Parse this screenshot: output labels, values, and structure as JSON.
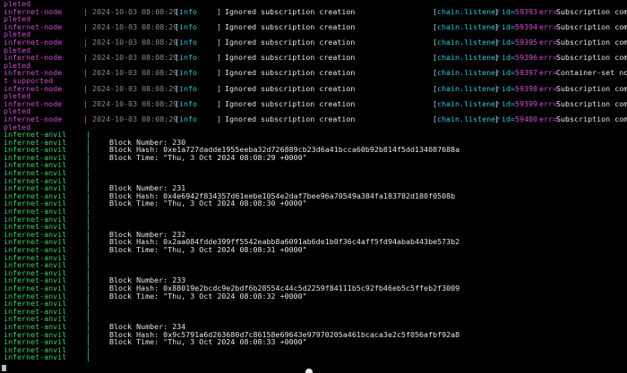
{
  "window": {
    "title": ""
  },
  "first_line_clipped": "pleted",
  "node_logs": [
    {
      "source": "infernet-node",
      "timestamp": "2024-10-03 08:08:29",
      "level": "info",
      "message": "Ignored subscription creation",
      "component": "chain.listener",
      "id": "59393",
      "err": "Subscription com",
      "wrap": "pleted"
    },
    {
      "source": "infernet-node",
      "timestamp": "2024-10-03 08:08:29",
      "level": "info",
      "message": "Ignored subscription creation",
      "component": "chain.listener",
      "id": "59394",
      "err": "Subscription com",
      "wrap": "pleted"
    },
    {
      "source": "infernet-node",
      "timestamp": "2024-10-03 08:08:29",
      "level": "info",
      "message": "Ignored subscription creation",
      "component": "chain.listener",
      "id": "59395",
      "err": "Subscription com",
      "wrap": "pleted"
    },
    {
      "source": "infernet-node",
      "timestamp": "2024-10-03 08:08:29",
      "level": "info",
      "message": "Ignored subscription creation",
      "component": "chain.listener",
      "id": "59396",
      "err": "Subscription com",
      "wrap": "pleted"
    },
    {
      "source": "infernet-node",
      "timestamp": "2024-10-03 08:08:29",
      "level": "info",
      "message": "Ignored subscription creation",
      "component": "chain.listener",
      "id": "59397",
      "err": "Container-set no",
      "wrap": "t supported"
    },
    {
      "source": "infernet-node",
      "timestamp": "2024-10-03 08:08:29",
      "level": "info",
      "message": "Ignored subscription creation",
      "component": "chain.listener",
      "id": "59398",
      "err": "Subscription com",
      "wrap": "pleted"
    },
    {
      "source": "infernet-node",
      "timestamp": "2024-10-03 08:08:29",
      "level": "info",
      "message": "Ignored subscription creation",
      "component": "chain.listener",
      "id": "59399",
      "err": "Subscription com",
      "wrap": "pleted"
    },
    {
      "source": "infernet-node",
      "timestamp": "2024-10-03 08:08:29",
      "level": "info",
      "message": "Ignored subscription creation",
      "component": "chain.listener",
      "id": "59400",
      "err": "Subscription com",
      "wrap": "pleted"
    }
  ],
  "anvil_source": "infernet-anvil",
  "anvil_labels": {
    "number": "Block Number:",
    "hash": "Block Hash:",
    "time": "Block Time:"
  },
  "blocks": [
    {
      "number": "230",
      "hash": "0xe1a727dadde1955eeba32d726889cb23d6a41bcca60b92b814f5dd134087688a",
      "time": "\"Thu, 3 Oct 2024 08:08:29 +0000\""
    },
    {
      "number": "231",
      "hash": "0x4e6942f834357d61eebe1054e2daf7bee96a70549a384fa183782d180f0508b",
      "time": "\"Thu, 3 Oct 2024 08:08:30 +0000\""
    },
    {
      "number": "232",
      "hash": "0x2aa084fdde399ff5542eabb8a6091ab6de1b0f36c4aff5fd94abab443be573b2",
      "time": "\"Thu, 3 Oct 2024 08:08:31 +0000\""
    },
    {
      "number": "233",
      "hash": "0x88019e2bcdc9e2bdf6b28554c44c5d2259f84111b5c92fb46eb5c5ffeb2f3009",
      "time": "\"Thu, 3 Oct 2024 08:08:32 +0000\""
    },
    {
      "number": "234",
      "hash": "0x9c5791a6d263680d7c86158e69643e97970205a461bcaca3e2c5f056afbf92a8",
      "time": "\"Thu, 3 Oct 2024 08:08:33 +0000\""
    }
  ],
  "colors": {
    "node": "#d64bd6",
    "anvil": "#3ad36a",
    "info": "#31c6e0",
    "text": "#e6e6e6",
    "timestamp": "#8a8a8a"
  }
}
